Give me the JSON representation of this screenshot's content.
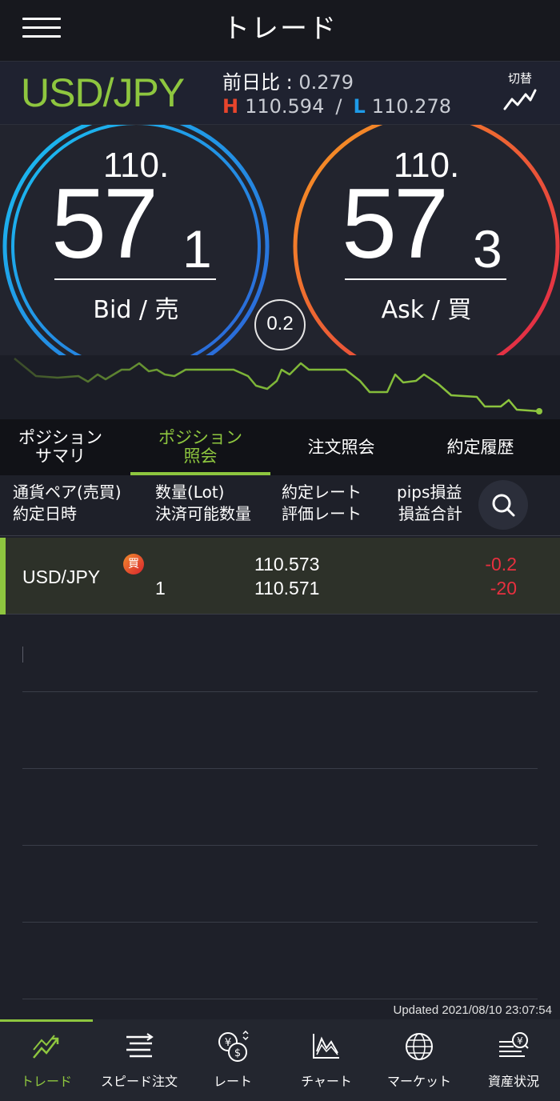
{
  "header": {
    "title": "トレード"
  },
  "pair": {
    "name": "USD/JPY",
    "prev_label": "前日比 : ",
    "prev_value": "0.279",
    "high_label": "H",
    "high": "110.594",
    "separator": "/",
    "low_label": "L",
    "low": "110.278",
    "switch_label": "切替"
  },
  "rates": {
    "bid": {
      "top": "110.",
      "big": "57",
      "small": "1",
      "label": "Bid / 売"
    },
    "ask": {
      "top": "110.",
      "big": "57",
      "small": "3",
      "label": "Ask / 買"
    },
    "spread": "0.2"
  },
  "colors": {
    "accent": "#8ec63f",
    "bid_ring_start": "#19c2f2",
    "bid_ring_end": "#2d5fd6",
    "ask_ring_start": "#f79a21",
    "ask_ring_end": "#e01f4a",
    "loss": "#e8303f"
  },
  "tabs": [
    {
      "label": "ポジション\nサマリ",
      "active": false
    },
    {
      "label": "ポジション\n照会",
      "active": true
    },
    {
      "label": "注文照会",
      "active": false
    },
    {
      "label": "約定履歴",
      "active": false
    }
  ],
  "columns": {
    "c1a": "通貨ペア(売買)",
    "c1b": "約定日時",
    "c2a": "数量(Lot)",
    "c2b": "決済可能数量",
    "c3a": "約定レート",
    "c3b": "評価レート",
    "c4a": "pips損益",
    "c4b": "損益合計",
    "search_icon": "search-icon"
  },
  "position": {
    "pair": "USD/JPY",
    "side_badge": "買",
    "quantity": "1",
    "contract_rate": "110.573",
    "eval_rate": "110.571",
    "pips": "-0.2",
    "total": "-20"
  },
  "updated": "Updated  2021/08/10 23:07:54",
  "nav": [
    {
      "label": "トレード",
      "icon": "trade-icon",
      "active": true
    },
    {
      "label": "スピード注文",
      "icon": "speed-order-icon",
      "active": false
    },
    {
      "label": "レート",
      "icon": "rate-icon",
      "active": false
    },
    {
      "label": "チャート",
      "icon": "chart-icon",
      "active": false
    },
    {
      "label": "マーケット",
      "icon": "market-globe-icon",
      "active": false
    },
    {
      "label": "資産状況",
      "icon": "assets-icon",
      "active": false
    }
  ]
}
